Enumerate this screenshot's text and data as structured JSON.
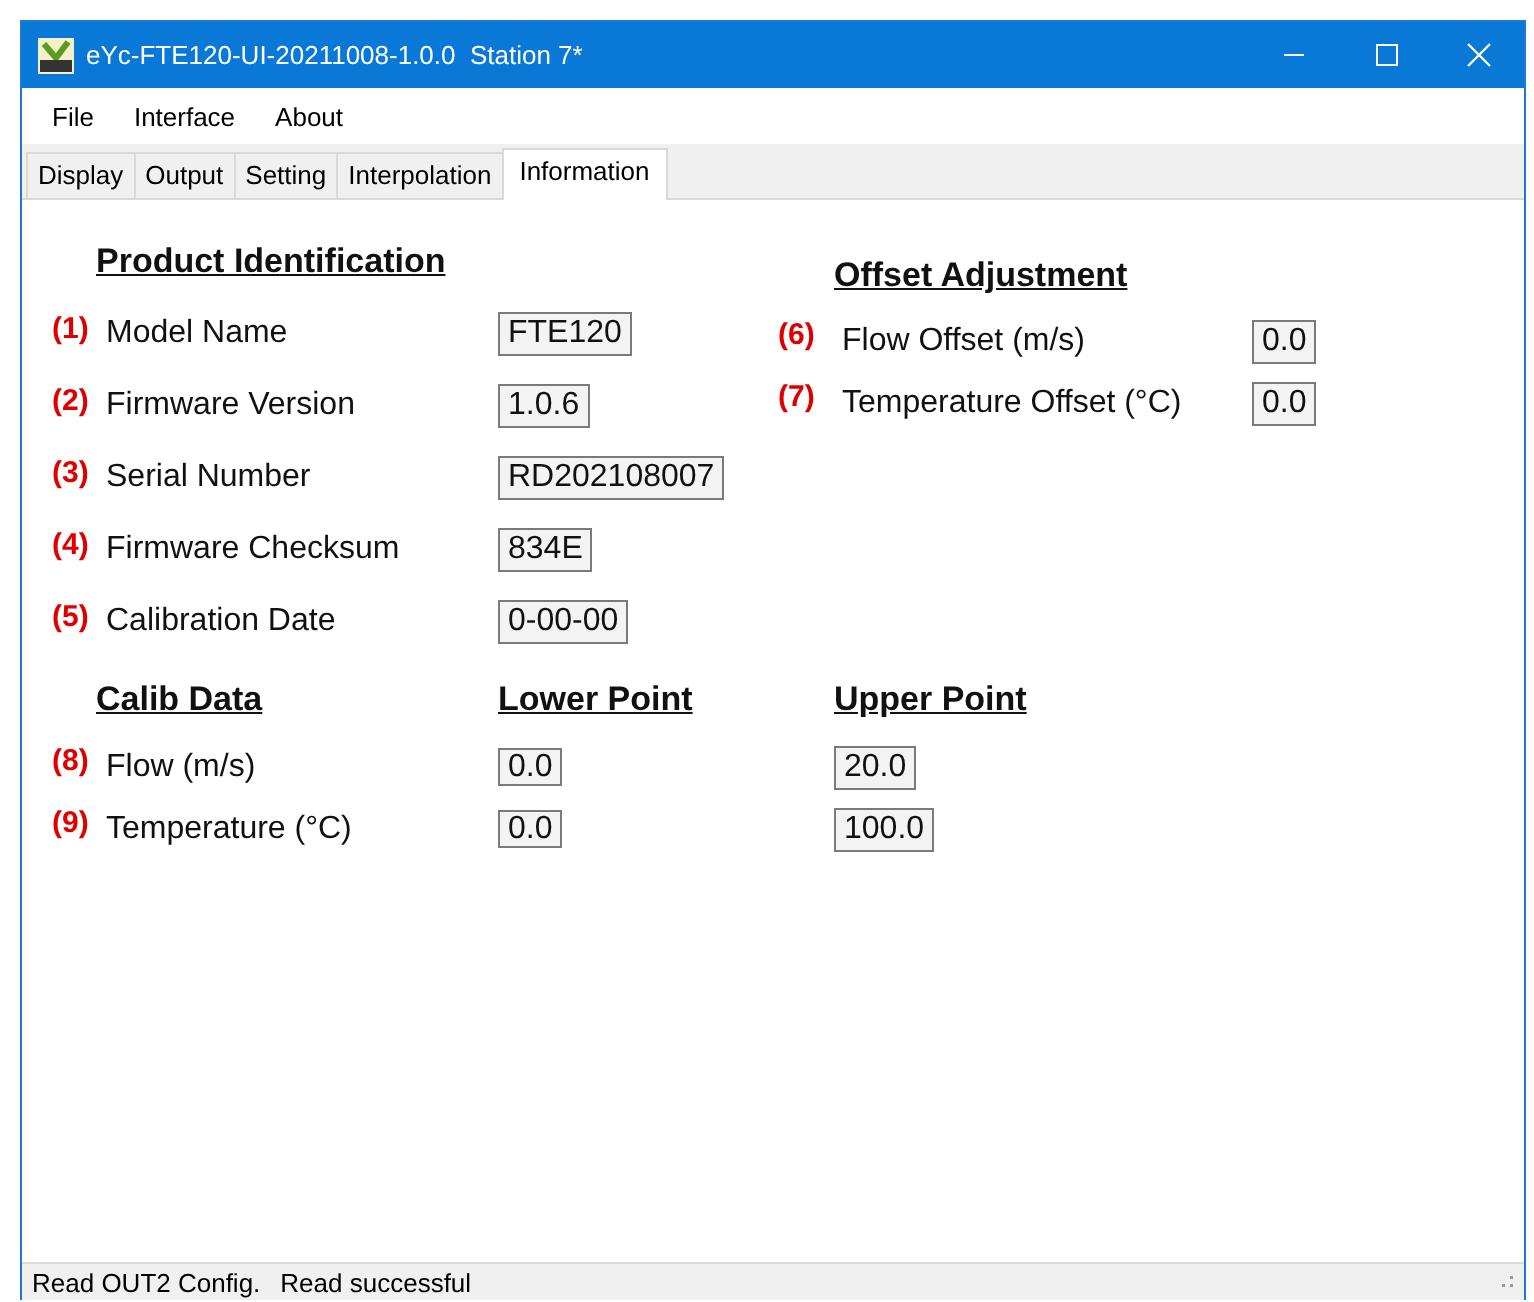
{
  "window": {
    "title": "eYc-FTE120-UI-20211008-1.0.0  Station 7*"
  },
  "menu": [
    "File",
    "Interface",
    "About"
  ],
  "tabs": [
    {
      "label": "Display",
      "selected": false
    },
    {
      "label": "Output",
      "selected": false
    },
    {
      "label": "Setting",
      "selected": false
    },
    {
      "label": "Interpolation",
      "selected": false
    },
    {
      "label": "Information",
      "selected": true
    }
  ],
  "product_identification": {
    "heading": "Product Identification",
    "rows": [
      {
        "marker": "(1)",
        "label": "Model Name",
        "value": "FTE120"
      },
      {
        "marker": "(2)",
        "label": "Firmware Version",
        "value": "1.0.6"
      },
      {
        "marker": "(3)",
        "label": "Serial Number",
        "value": "RD202108007"
      },
      {
        "marker": "(4)",
        "label": "Firmware Checksum",
        "value": "834E"
      },
      {
        "marker": "(5)",
        "label": "Calibration Date",
        "value": "0-00-00"
      }
    ]
  },
  "offset_adjustment": {
    "heading": "Offset Adjustment",
    "rows": [
      {
        "marker": "(6)",
        "label": "Flow Offset (m/s)",
        "value": "0.0"
      },
      {
        "marker": "(7)",
        "label": "Temperature Offset (°C)",
        "value": "0.0"
      }
    ]
  },
  "calib_data": {
    "headings": [
      "Calib Data",
      "Lower Point",
      "Upper Point"
    ],
    "rows": [
      {
        "marker": "(8)",
        "label": "Flow (m/s)",
        "lower": "0.0",
        "upper": "20.0"
      },
      {
        "marker": "(9)",
        "label": "Temperature (°C)",
        "lower": "0.0",
        "upper": "100.0"
      }
    ]
  },
  "status_bar": [
    "Read OUT2 Config.",
    "Read successful"
  ]
}
